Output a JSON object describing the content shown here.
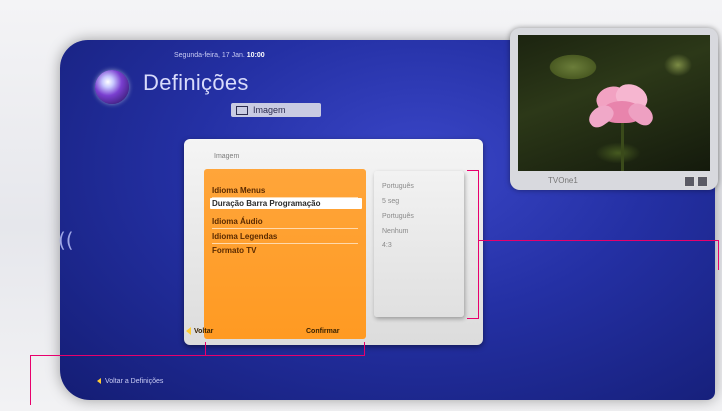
{
  "header": {
    "date": "Segunda-feira, 17 Jan.",
    "time": "10:00",
    "title": "Definições",
    "tab_label": "Imagem"
  },
  "preview": {
    "channel": "TVOne1"
  },
  "dialog": {
    "title": "Imagem",
    "menu_items": [
      "Idioma Menus",
      "Duração Barra Programação",
      "Idioma Áudio",
      "Idioma Legendas",
      "Formato TV"
    ],
    "selected_index": 1,
    "values": [
      "Português",
      "5 seg",
      "Português",
      "Nenhum",
      "4:3"
    ],
    "back_label": "Voltar",
    "confirm_label": "Confirmar"
  },
  "footer": {
    "back_to_settings": "Voltar a Definições"
  },
  "colors": {
    "panel_blue": "#2430a4",
    "menu_orange": "#ff9a22",
    "callout_line": "#e8006c",
    "highlight_arrow": "#ffcc33"
  },
  "icons": [
    "logo-disc",
    "image-icon",
    "back-arrow-icon",
    "remote-signal-icon",
    "pip-toggle-icon"
  ]
}
